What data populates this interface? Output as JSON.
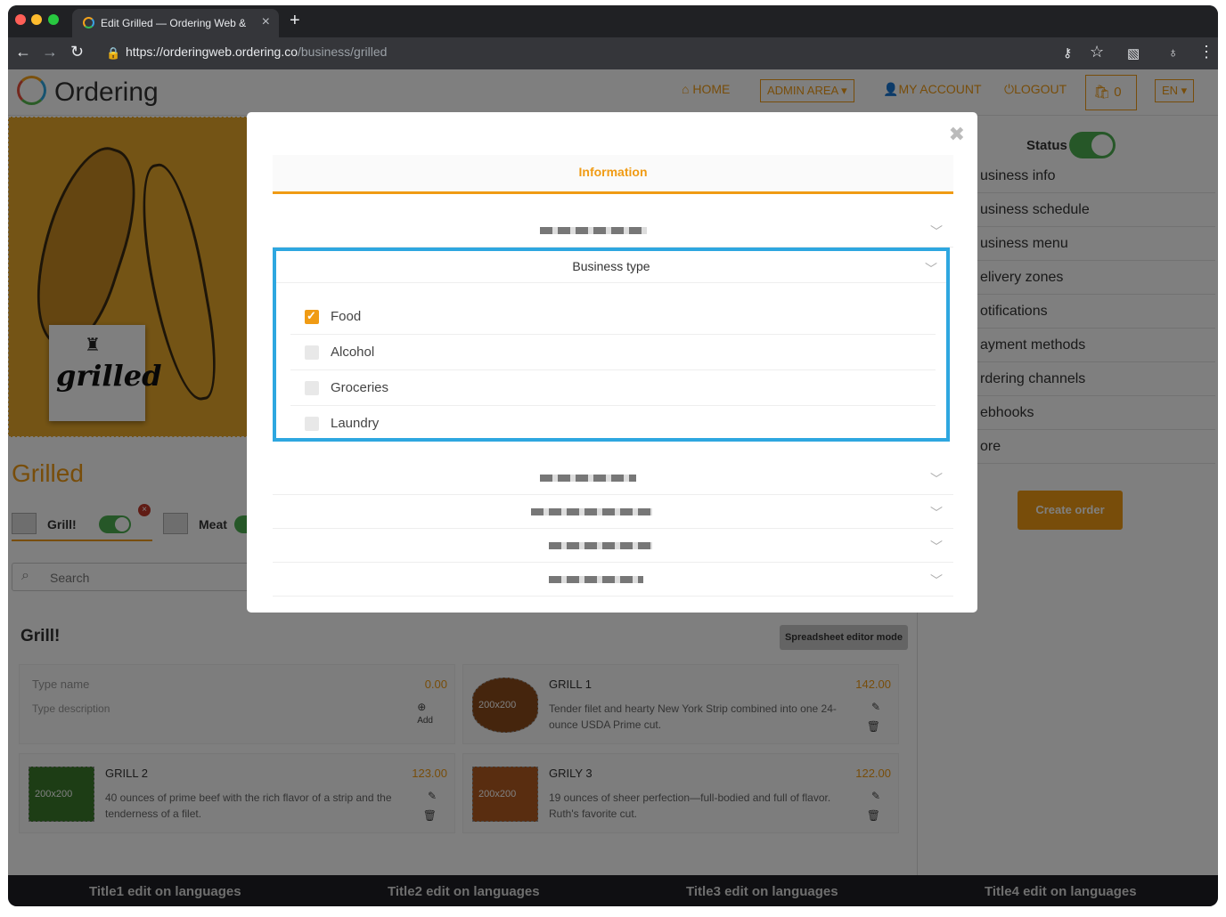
{
  "browser": {
    "tab_title": "Edit Grilled — Ordering Web &",
    "new_tab": "+",
    "url_host": "https://orderingweb.ordering.co",
    "url_path": "/business/grilled"
  },
  "header": {
    "logo": "Ordering",
    "nav_home": "HOME",
    "nav_admin": "ADMIN AREA ▾",
    "nav_account": "MY ACCOUNT",
    "nav_logout": "LOGOUT",
    "cart_count": "0",
    "language": "EN ▾"
  },
  "business": {
    "name": "Grilled",
    "logo_word": "grilled",
    "categories": [
      {
        "label": "Grill!"
      },
      {
        "label": "Meat"
      }
    ],
    "search_placeholder": "Search"
  },
  "sidebar": {
    "status_label": "Status",
    "items": [
      "usiness info",
      "usiness schedule",
      "usiness menu",
      "elivery zones",
      "otifications",
      "ayment methods",
      "rdering channels",
      "ebhooks",
      "ore"
    ],
    "create_order": "Create order"
  },
  "products": {
    "category_title": "Grill!",
    "spreadsheet_button": "Spreadsheet editor mode",
    "new_item": {
      "name_placeholder": "Type name",
      "desc_placeholder": "Type description",
      "price": "0.00",
      "add_label": "Add"
    },
    "items": [
      {
        "name": "GRILL 1",
        "price": "142.00",
        "desc": "Tender filet and hearty New York Strip combined into one 24-ounce USDA Prime cut.",
        "img": "200x200"
      },
      {
        "name": "GRILL 2",
        "price": "123.00",
        "desc": "40 ounces of prime beef with the rich flavor of a strip and the tenderness of a filet.",
        "img": "200x200"
      },
      {
        "name": "GRILY 3",
        "price": "122.00",
        "desc": "19 ounces of sheer perfection—full-bodied and full of flavor. Ruth's favorite cut.",
        "img": "200x200"
      }
    ]
  },
  "footer": {
    "titles": [
      "Title1 edit on languages",
      "Title2 edit on languages",
      "Title3 edit on languages",
      "Title4 edit on languages"
    ]
  },
  "modal": {
    "close": "✖",
    "tab": "Information",
    "business_type": {
      "title": "Business type",
      "options": [
        {
          "label": "Food",
          "checked": true
        },
        {
          "label": "Alcohol",
          "checked": false
        },
        {
          "label": "Groceries",
          "checked": false
        },
        {
          "label": "Laundry",
          "checked": false
        }
      ]
    }
  },
  "colors": {
    "accent": "#f09b14",
    "highlight": "#2ea7e0",
    "toggle": "#4caf50"
  }
}
